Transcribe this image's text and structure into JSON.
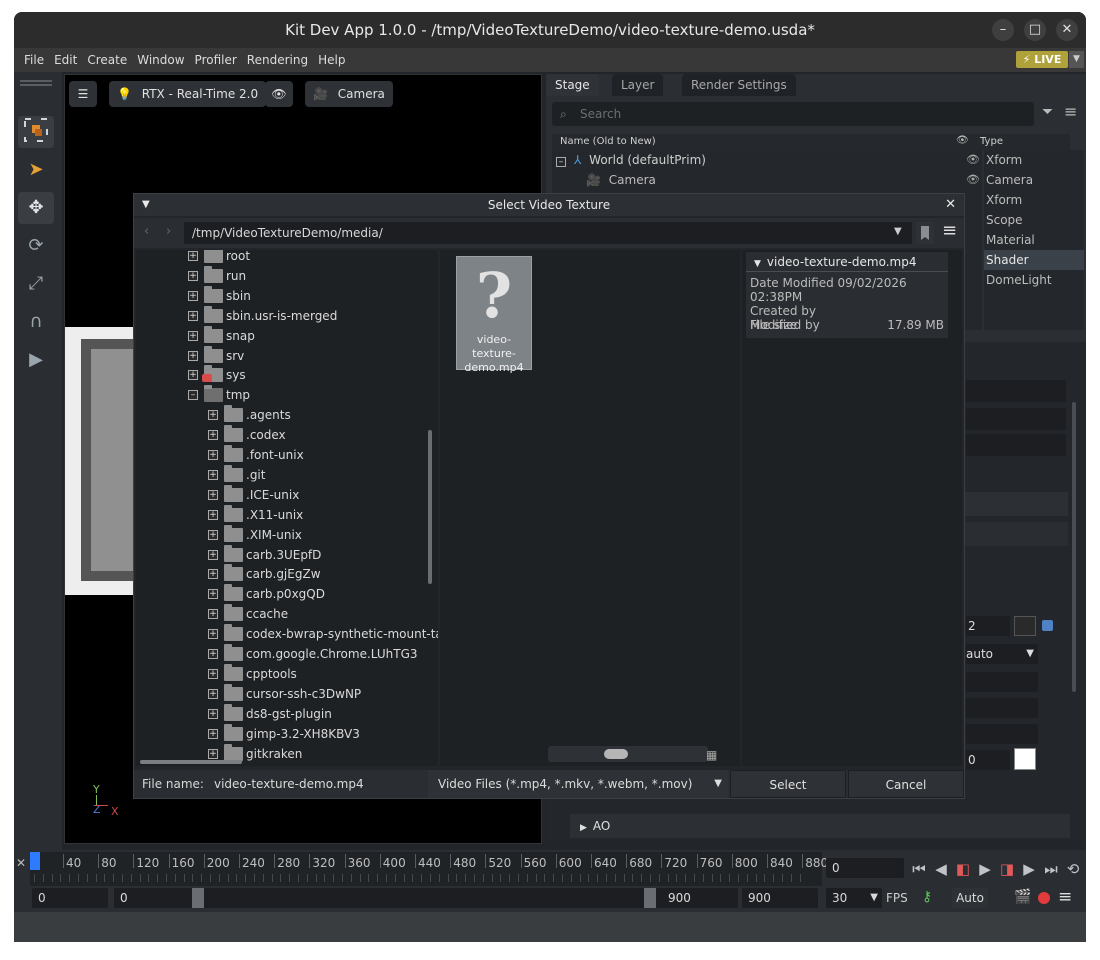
{
  "window": {
    "title": "Kit Dev App 1.0.0 - /tmp/VideoTextureDemo/video-texture-demo.usda*"
  },
  "menu": [
    "File",
    "Edit",
    "Create",
    "Window",
    "Profiler",
    "Rendering",
    "Help"
  ],
  "live_label": "LIVE",
  "viewport": {
    "renderer": "RTX - Real-Time 2.0",
    "camera": "Camera"
  },
  "stage": {
    "tabs": [
      "Stage",
      "Layer",
      "Render Settings"
    ],
    "search_placeholder": "Search",
    "col_name": "Name (Old to New)",
    "col_type": "Type",
    "rows": [
      {
        "name": "World (defaultPrim)",
        "type": "Xform"
      },
      {
        "name": "Camera",
        "type": "Camera"
      },
      {
        "name": "",
        "type": "Xform"
      },
      {
        "name": "",
        "type": "Scope"
      },
      {
        "name": "",
        "type": "Material"
      },
      {
        "name": "",
        "type": "Shader"
      },
      {
        "name": "",
        "type": "DomeLight"
      }
    ]
  },
  "props": {
    "field_2": "2",
    "field_auto": "auto",
    "field_0": "0",
    "section_ao": "AO"
  },
  "axis": {
    "y": "Y",
    "z": "Z",
    "x": "X"
  },
  "dialog": {
    "title": "Select Video Texture",
    "path": "/tmp/VideoTextureDemo/media/",
    "tree": [
      {
        "label": "root",
        "level": 0,
        "expanded": false
      },
      {
        "label": "run",
        "level": 0,
        "expanded": false
      },
      {
        "label": "sbin",
        "level": 0,
        "expanded": false
      },
      {
        "label": "sbin.usr-is-merged",
        "level": 0,
        "expanded": false
      },
      {
        "label": "snap",
        "level": 0,
        "expanded": false
      },
      {
        "label": "srv",
        "level": 0,
        "expanded": false
      },
      {
        "label": "sys",
        "level": 0,
        "expanded": false,
        "locked": true
      },
      {
        "label": "tmp",
        "level": 0,
        "expanded": true
      },
      {
        "label": ".agents",
        "level": 1,
        "expanded": false
      },
      {
        "label": ".codex",
        "level": 1,
        "expanded": false
      },
      {
        "label": ".font-unix",
        "level": 1,
        "expanded": false
      },
      {
        "label": ".git",
        "level": 1,
        "expanded": false
      },
      {
        "label": ".ICE-unix",
        "level": 1,
        "expanded": false
      },
      {
        "label": ".X11-unix",
        "level": 1,
        "expanded": false
      },
      {
        "label": ".XIM-unix",
        "level": 1,
        "expanded": false
      },
      {
        "label": "carb.3UEpfD",
        "level": 1,
        "expanded": false
      },
      {
        "label": "carb.gjEgZw",
        "level": 1,
        "expanded": false
      },
      {
        "label": "carb.p0xgQD",
        "level": 1,
        "expanded": false
      },
      {
        "label": "ccache",
        "level": 1,
        "expanded": false
      },
      {
        "label": "codex-bwrap-synthetic-mount-tar",
        "level": 1,
        "expanded": false
      },
      {
        "label": "com.google.Chrome.LUhTG3",
        "level": 1,
        "expanded": false
      },
      {
        "label": "cpptools",
        "level": 1,
        "expanded": false
      },
      {
        "label": "cursor-ssh-c3DwNP",
        "level": 1,
        "expanded": false
      },
      {
        "label": "ds8-gst-plugin",
        "level": 1,
        "expanded": false
      },
      {
        "label": "gimp-3.2-XH8KBV3",
        "level": 1,
        "expanded": false
      },
      {
        "label": "gitkraken",
        "level": 1,
        "expanded": false
      }
    ],
    "file": {
      "name_line1": "video-texture-",
      "name_line2": "demo.mp4",
      "icon": "question-mark-icon"
    },
    "details": {
      "header": "video-texture-demo.mp4",
      "date_label": "Date Modified",
      "date_value": "09/02/2026 02:38PM",
      "created_by": "Created by",
      "modified_by": "Modified by",
      "size_label": "File size",
      "size_value": "17.89 MB"
    },
    "filename_label": "File name:",
    "filename_value": "video-texture-demo.mp4",
    "filter": "Video Files (*.mp4, *.mkv, *.webm, *.mov)",
    "select_label": "Select",
    "cancel_label": "Cancel"
  },
  "timeline": {
    "ticks": [
      "40",
      "80",
      "120",
      "160",
      "200",
      "240",
      "280",
      "320",
      "360",
      "400",
      "440",
      "480",
      "520",
      "560",
      "600",
      "640",
      "680",
      "720",
      "760",
      "800",
      "840",
      "880"
    ],
    "current_frame": "0",
    "start_time": "0",
    "range_start": "0",
    "range_end": "900",
    "end_time": "900",
    "fps_value": "30",
    "fps_label": "FPS",
    "auto_label": "Auto"
  },
  "colors": {
    "live": "#b0a23a",
    "playhead": "#2f7bff",
    "record": "#e23b3b"
  }
}
